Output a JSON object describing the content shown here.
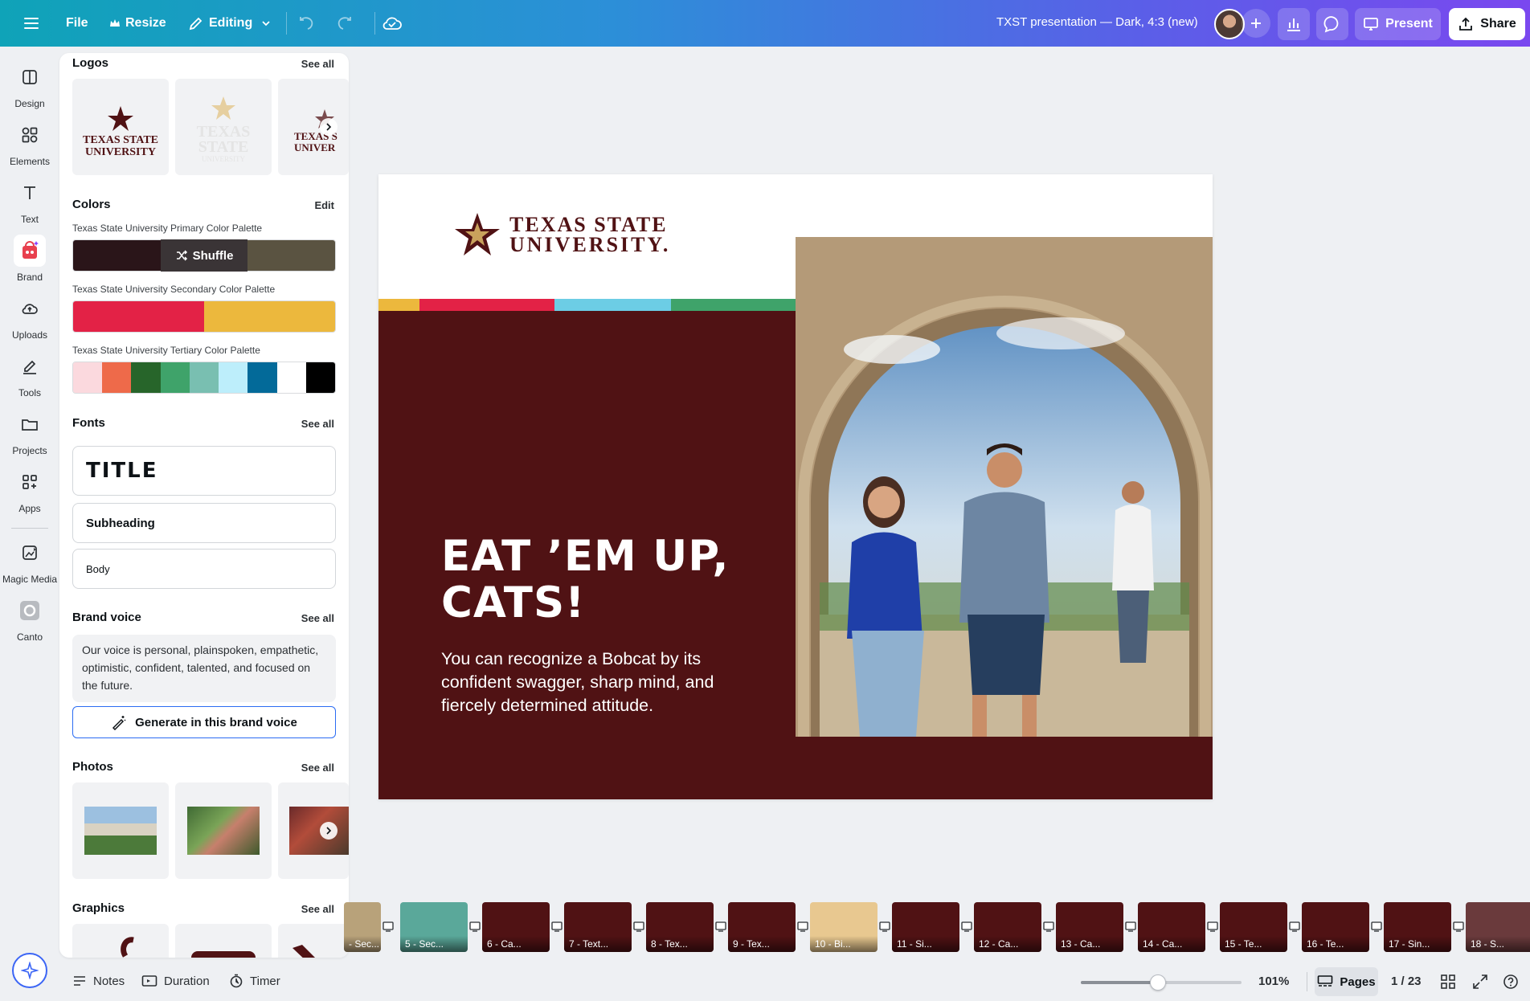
{
  "topbar": {
    "file_label": "File",
    "resize_label": "Resize",
    "editing_label": "Editing",
    "doc_title": "TXST presentation — Dark, 4:3 (new)",
    "present_label": "Present",
    "share_label": "Share"
  },
  "rail": {
    "items": [
      {
        "label": "Design",
        "icon": "design-icon"
      },
      {
        "label": "Elements",
        "icon": "elements-icon"
      },
      {
        "label": "Text",
        "icon": "text-icon"
      },
      {
        "label": "Brand",
        "icon": "brand-icon"
      },
      {
        "label": "Uploads",
        "icon": "uploads-icon"
      },
      {
        "label": "Tools",
        "icon": "tools-icon"
      },
      {
        "label": "Projects",
        "icon": "projects-icon"
      },
      {
        "label": "Apps",
        "icon": "apps-icon"
      },
      {
        "label": "Magic Media",
        "icon": "magic-media-icon"
      },
      {
        "label": "Canto",
        "icon": "canto-icon"
      }
    ],
    "active": "Brand"
  },
  "panel": {
    "logos": {
      "title": "Logos",
      "see_all": "See all",
      "logo_line1": "TEXAS STATE",
      "logo_line2": "UNIVERSITY"
    },
    "colors": {
      "title": "Colors",
      "edit": "Edit",
      "shuffle": "Shuffle",
      "primary_label": "Texas State University Primary Color Palette",
      "primary": [
        "#2a1519",
        "#2e171a",
        "#5a5341"
      ],
      "secondary_label": "Texas State University Secondary Color Palette",
      "secondary": [
        "#e32246",
        "#ecb83d"
      ],
      "tertiary_label": "Texas State University Tertiary Color Palette",
      "tertiary": [
        "#fbd9de",
        "#ee6a4a",
        "#27652a",
        "#3fa36a",
        "#79bfb1",
        "#bdeefb",
        "#036a99",
        "#ffffff",
        "#000000"
      ]
    },
    "fonts": {
      "title": "Fonts",
      "see_all": "See all",
      "title_sample": "TITLE",
      "subheading_sample": "Subheading",
      "body_sample": "Body"
    },
    "brand_voice": {
      "title": "Brand voice",
      "see_all": "See all",
      "text": "Our voice is personal, plainspoken, empathetic, optimistic, confident, talented, and focused on the future.",
      "generate": "Generate in this brand voice"
    },
    "photos": {
      "title": "Photos",
      "see_all": "See all"
    },
    "graphics": {
      "title": "Graphics",
      "see_all": "See all"
    }
  },
  "slide": {
    "logo_line1": "TEXAS STATE",
    "logo_line2": "UNIVERSITY.",
    "heading": "EAT ’EM UP, CATS!",
    "body": "You can recognize a Bobcat by its confident swagger, sharp mind, and fiercely determined attitude.",
    "stripe_colors": [
      "#ecb83d",
      "#e32246",
      "#6ccde5",
      "#3fa36a"
    ],
    "maroon": "#501214"
  },
  "filmstrip": [
    {
      "label": "- Sec...",
      "color": "#b8a27a"
    },
    {
      "label": "5 - Sec...",
      "color": "#5aa89a"
    },
    {
      "label": "6 - Ca...",
      "color": "#501214"
    },
    {
      "label": "7 - Text...",
      "color": "#501214"
    },
    {
      "label": "8 - Tex...",
      "color": "#501214"
    },
    {
      "label": "9 - Tex...",
      "color": "#501214"
    },
    {
      "label": "10 - Bi...",
      "color": "#e8c890"
    },
    {
      "label": "11 - Si...",
      "color": "#501214"
    },
    {
      "label": "12 - Ca...",
      "color": "#501214"
    },
    {
      "label": "13 - Ca...",
      "color": "#501214"
    },
    {
      "label": "14 - Ca...",
      "color": "#501214"
    },
    {
      "label": "15 - Te...",
      "color": "#501214"
    },
    {
      "label": "16 - Te...",
      "color": "#501214"
    },
    {
      "label": "17 - Sin...",
      "color": "#501214"
    },
    {
      "label": "18 - S...",
      "color": "#6a3a3c"
    }
  ],
  "bottombar": {
    "notes": "Notes",
    "duration": "Duration",
    "timer": "Timer",
    "zoom": "101%",
    "zoom_fraction": 0.48,
    "pages": "Pages",
    "page_count": "1 / 23"
  }
}
